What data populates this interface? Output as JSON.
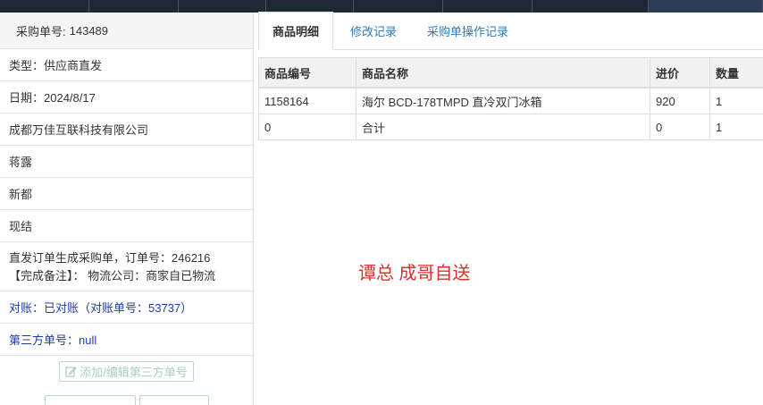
{
  "order": {
    "header_label": "采购单号:",
    "header_no": "143489",
    "type": "类型：供应商直发",
    "date": "日期：2024/8/17",
    "company": "成都万佳互联科技有限公司",
    "person": "蒋露",
    "region": "新都",
    "payment": "现结",
    "remark_line1": "直发订单生成采购单，订单号：246216",
    "remark_line2": "【完成备注】： 物流公司：商家自已物流",
    "reconcile": "对账：已对账（对账单号：53737）",
    "third_party": "第三方单号：null",
    "btn_third_party": "添加/编辑第三方单号"
  },
  "tabs": [
    {
      "label": "商品明细"
    },
    {
      "label": "修改记录"
    },
    {
      "label": "采购单操作记录"
    }
  ],
  "table": {
    "headers": [
      "商品编号",
      "商品名称",
      "进价",
      "数量"
    ],
    "rows": [
      [
        "1158164",
        "海尔 BCD-178TMPD 直冷双门冰箱",
        "920",
        "1"
      ],
      [
        "0",
        "合计",
        "0",
        "1"
      ]
    ]
  },
  "note": "谭总 成哥自送",
  "colors": {
    "topbar": "#1e2834",
    "link": "#337ab7",
    "note": "#d9302c",
    "blue_text": "#1f3ea8",
    "ghost_button": "#a9cfc5"
  },
  "icons": [
    "edit-icon"
  ]
}
